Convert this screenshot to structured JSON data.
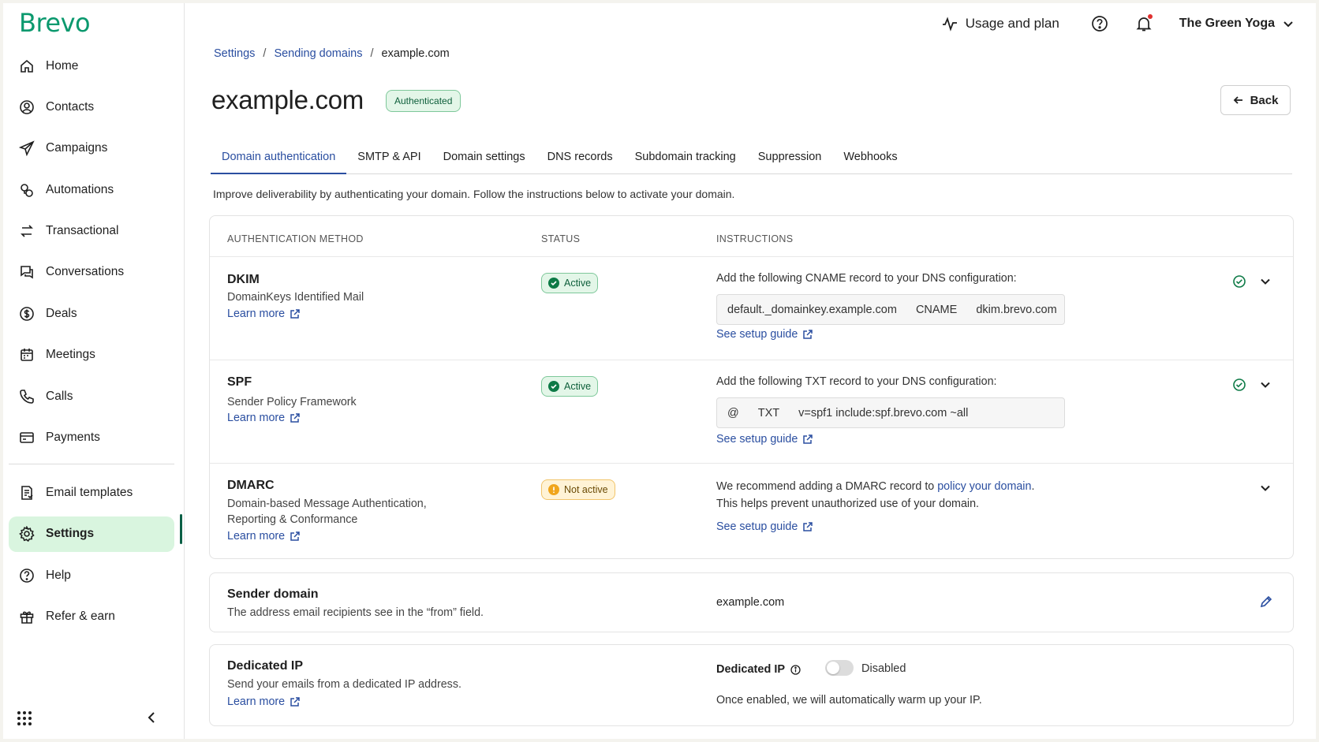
{
  "sidebar": {
    "logo": "Brevo",
    "items": [
      {
        "label": "Home",
        "icon": "home-icon"
      },
      {
        "label": "Contacts",
        "icon": "contacts-icon"
      },
      {
        "label": "Campaigns",
        "icon": "send-icon"
      },
      {
        "label": "Automations",
        "icon": "automation-icon"
      },
      {
        "label": "Transactional",
        "icon": "swap-arrows-icon"
      },
      {
        "label": "Conversations",
        "icon": "chat-icon"
      },
      {
        "label": "Deals",
        "icon": "dollar-icon"
      },
      {
        "label": "Meetings",
        "icon": "calendar-icon"
      },
      {
        "label": "Calls",
        "icon": "phone-icon"
      },
      {
        "label": "Payments",
        "icon": "card-icon"
      }
    ],
    "items2": [
      {
        "label": "Email templates",
        "icon": "template-icon"
      },
      {
        "label": "Settings",
        "icon": "gear-icon",
        "active": true
      },
      {
        "label": "Help",
        "icon": "help-icon"
      },
      {
        "label": "Refer & earn",
        "icon": "gift-icon"
      }
    ]
  },
  "topbar": {
    "usage_label": "Usage and plan",
    "account_name": "The Green Yoga"
  },
  "breadcrumb": [
    "Settings",
    "Sending domains",
    "example.com"
  ],
  "page": {
    "title": "example.com",
    "badge": "Authenticated",
    "back_label": "Back"
  },
  "tabs": [
    "Domain authentication",
    "SMTP & API",
    "Domain settings",
    "DNS records",
    "Subdomain tracking",
    "Suppression",
    "Webhooks"
  ],
  "intro": "Improve deliverability by authenticating your domain. Follow the instructions below to activate your domain.",
  "table": {
    "headers": [
      "AUTHENTICATION METHOD",
      "STATUS",
      "INSTRUCTIONS"
    ],
    "rows": [
      {
        "name": "DKIM",
        "desc": "DomainKeys Identified Mail",
        "learn_more": "Learn more",
        "status": "Active",
        "instruction": "Add the following CNAME record to your DNS configuration:",
        "record": [
          "default._domainkey.example.com",
          "CNAME",
          "dkim.brevo.com"
        ],
        "guide": "See setup guide"
      },
      {
        "name": "SPF",
        "desc": "Sender Policy Framework",
        "learn_more": "Learn more",
        "status": "Active",
        "instruction": "Add the following TXT record to your DNS configuration:",
        "record": [
          "@",
          "TXT",
          "v=spf1 include:spf.brevo.com ~all"
        ],
        "guide": "See setup guide"
      },
      {
        "name": "DMARC",
        "desc1": "Domain-based Message Authentication,",
        "desc2": "Reporting & Conformance",
        "learn_more": "Learn more",
        "status": "Not active",
        "instruction_pre": "We recommend adding a DMARC record to ",
        "instruction_link": "policy your domain",
        "instruction_post": ".",
        "instruction2": "This helps prevent unauthorized use of your domain.",
        "guide": "See setup guide"
      }
    ]
  },
  "sender_domain": {
    "title": "Sender domain",
    "desc": "The address email recipients see in the “from” field.",
    "value": "example.com"
  },
  "dedicated_ip": {
    "title": "Dedicated IP",
    "desc": "Send your emails from a dedicated IP address.",
    "learn_more": "Learn more",
    "label": "Dedicated IP",
    "toggle_state": "Disabled",
    "note": "Once enabled, we will automatically warm up your IP."
  },
  "colors": {
    "brand": "#0b996e",
    "link": "#2a4ea0",
    "active_nav": "#d9f5df",
    "ok_badge": "#e3f6e8",
    "warn_badge": "#fff3d6"
  }
}
